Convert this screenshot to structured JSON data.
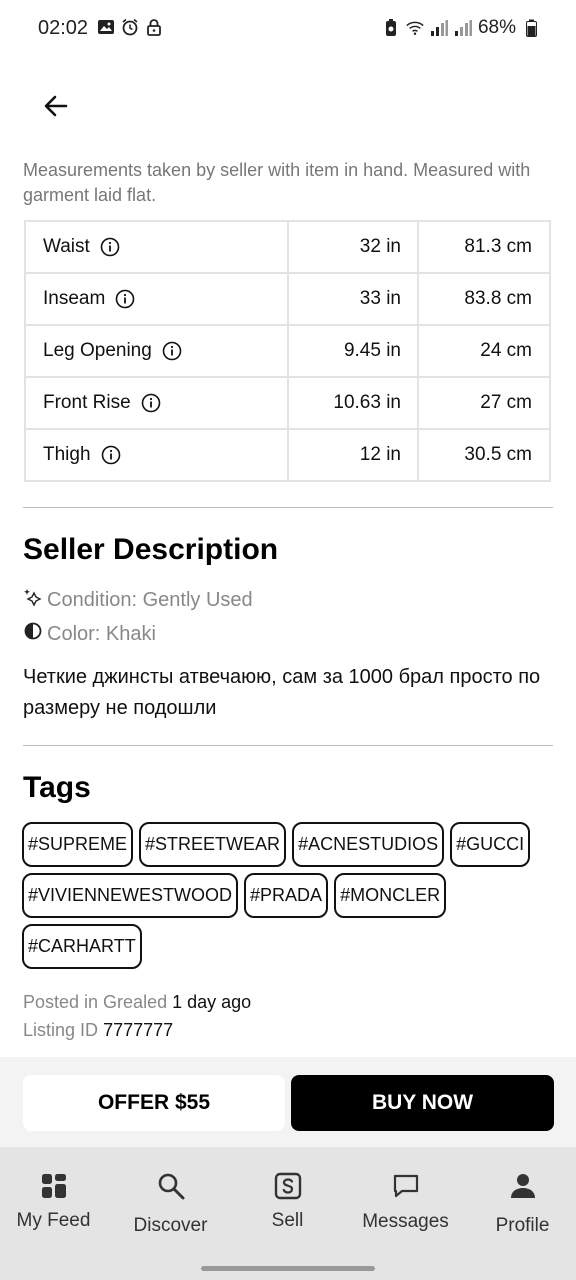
{
  "status_bar": {
    "time": "02:02",
    "battery": "68%"
  },
  "measurements": {
    "note": "Measurements taken by seller with item in hand. Measured with garment laid flat.",
    "rows": [
      {
        "label": "Waist",
        "inches": "32 in",
        "cm": "81.3 cm"
      },
      {
        "label": "Inseam",
        "inches": "33 in",
        "cm": "83.8 cm"
      },
      {
        "label": "Leg Opening",
        "inches": "9.45 in",
        "cm": "24 cm"
      },
      {
        "label": "Front Rise",
        "inches": "10.63 in",
        "cm": "27 cm"
      },
      {
        "label": "Thigh",
        "inches": "12 in",
        "cm": "30.5 cm"
      }
    ]
  },
  "seller_description": {
    "title": "Seller Description",
    "condition": "Condition: Gently Used",
    "color": "Color: Khaki",
    "text": "Четкие джинсты атвечаюю, сам за 1000 брал просто по размеру не подошли"
  },
  "tags": {
    "title": "Tags",
    "items": [
      "#SUPREME",
      "#STREETWEAR",
      "#ACNESTUDIOS",
      "#GUCCI",
      "#VIVIENNEWESTWOOD",
      "#PRADA",
      "#MONCLER",
      "#CARHARTT"
    ]
  },
  "meta": {
    "posted_prefix": "Posted in Grealed",
    "posted_time": "1 day ago",
    "listing_prefix": "Listing ID",
    "listing_id": "7777777"
  },
  "actions": {
    "offer_label": "OFFER $55",
    "buy_label": "BUY NOW"
  },
  "nav": {
    "items": [
      {
        "label": "My Feed",
        "icon": "grid-icon"
      },
      {
        "label": "Discover",
        "icon": "search-icon"
      },
      {
        "label": "Sell",
        "icon": "sell-icon"
      },
      {
        "label": "Messages",
        "icon": "chat-icon"
      },
      {
        "label": "Profile",
        "icon": "person-icon"
      }
    ]
  }
}
